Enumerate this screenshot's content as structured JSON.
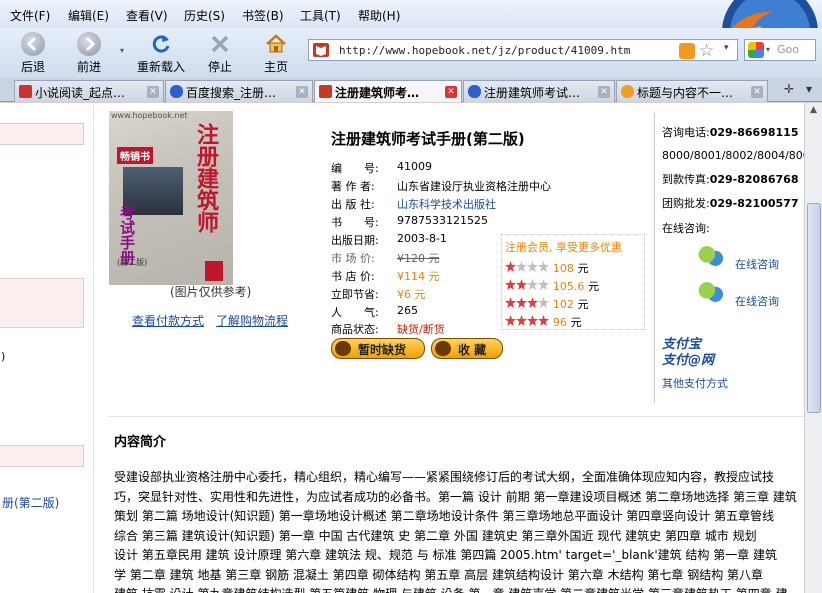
{
  "browser": {
    "menu": [
      "文件(F)",
      "编辑(E)",
      "查看(V)",
      "历史(S)",
      "书签(B)",
      "工具(T)",
      "帮助(H)"
    ],
    "nav": {
      "back": "后退",
      "forward": "前进",
      "reload": "重新载入",
      "stop": "停止",
      "home": "主页"
    },
    "url": "http://www.hopebook.net/jz/product/41009.htm",
    "search_placeholder": "Goo",
    "tabs": [
      {
        "label": "小说阅读_起点…",
        "active": false
      },
      {
        "label": "百度搜索_注册…",
        "active": false
      },
      {
        "label": "注册建筑师考…",
        "active": true
      },
      {
        "label": "注册建筑师考试…",
        "active": false
      },
      {
        "label": "标题与内容不一…",
        "active": false
      }
    ],
    "tab_controls": {
      "new": "✛",
      "list": "▾"
    }
  },
  "left": {
    "link_text": "册(第二版)",
    "marker": ")"
  },
  "book": {
    "cover_site": "www.hopebook.net",
    "cover_badge": "畅销书",
    "cover_title": "注册建筑师",
    "cover_title2": "考试手册",
    "cover_edition": "(第二版)",
    "cover_note": "(图片仅供参考)",
    "link_payment": "查看付款方式",
    "link_process": "了解购物流程",
    "title": "注册建筑师考试手册(第二版)",
    "fields": {
      "no_label": "编　　号:",
      "no": "41009",
      "author_label": "著 作 者:",
      "author": "山东省建设厅执业资格注册中心",
      "publisher_label": "出 版 社:",
      "publisher": "山东科学技术出版社",
      "isbn_label": "书　　号:",
      "isbn": "9787533121525",
      "date_label": "出版日期:",
      "date": "2003-8-1",
      "market_label": "市 场 价:",
      "market": "¥120 元",
      "store_label": "书 店 价:",
      "store": "¥114 元",
      "save_label": "立即节省:",
      "save": "¥6 元",
      "pop_label": "人　　气:",
      "pop": "265",
      "status_label": "商品状态:",
      "status": "缺货/断货"
    },
    "member_title": "注册会员, 享受更多优惠",
    "member_prices": [
      {
        "stars": 1,
        "price": "108",
        "unit": "元"
      },
      {
        "stars": 2,
        "price": "105.6",
        "unit": "元"
      },
      {
        "stars": 3,
        "price": "102",
        "unit": "元"
      },
      {
        "stars": 4,
        "price": "96",
        "unit": "元"
      }
    ],
    "btn_out": "暂时缺货",
    "btn_fav": "收 藏"
  },
  "contact": {
    "phone_label": "咨询电话:",
    "phone": "029-86698115",
    "phone2": "8000/8001/8002/8004/8005",
    "fax_label": "到款传真:",
    "fax": "029-82086768",
    "group_label": "团购批发:",
    "group": "029-82100577",
    "online_label": "在线咨询:",
    "online1": "在线咨询",
    "online2": "在线咨询",
    "alipay_line1": "支付宝",
    "alipay_line2": "支付@网",
    "other_pay": "其他支付方式"
  },
  "intro": {
    "heading": "内容简介",
    "lines": [
      "受建设部执业资格注册中心委托，精心组织，精心编写——紧紧围绕修订后的考试大纲，全面准确体现应知内容，教授应试技",
      "巧，突显针对性、实用性和先进性，为应试者成功的必备书。第一篇 设计 前期 第一章建设项目概述 第二章场地选择 第三章 建筑",
      "策划 第二篇 场地设计(知识题) 第一章场地设计概述 第二章场地设计条件 第三章场地总平面设计 第四章竖向设计 第五章管线",
      "综合 第三篇 建筑设计(知识题) 第一章 中国 古代建筑 史 第二章 外国 建筑史 第三章外国近 现代 建筑史 第四章 城市 规划",
      "设计 第五章民用 建筑 设计原理 第六章 建筑法 规、规范 与 标准 第四篇 2005.htm' target='_blank'建筑 结构 第一章 建筑",
      "学 第二章 建筑 地基 第三章 钢筋 混凝土 第四章 砌体结构 第五章 高层 建筑结构设计 第六章 木结构 第七章 钢结构 第八章",
      "建筑 抗震 设计 第九章建筑结构选型 第五篇建筑 物理 与建筑 设备 第一章 建筑声学 第二章建筑光学 第三章建筑热工 第四章 建"
    ]
  },
  "colors": {
    "accent": "#1a4aa8",
    "price": "#e8850b",
    "status": "#d81e06"
  }
}
